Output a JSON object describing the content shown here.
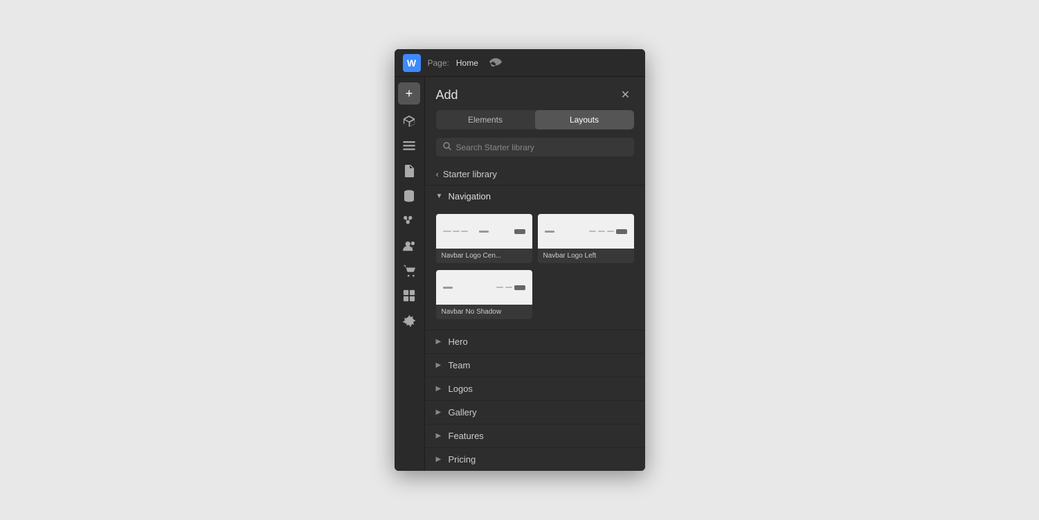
{
  "topbar": {
    "logo": "W",
    "page_prefix": "Page:",
    "page_name": "Home"
  },
  "sidebar": {
    "add_label": "+",
    "icons": [
      {
        "name": "cube-icon",
        "symbol": "⬡"
      },
      {
        "name": "layers-icon",
        "symbol": "≡"
      },
      {
        "name": "page-icon",
        "symbol": "❐"
      },
      {
        "name": "database-icon",
        "symbol": "◉"
      },
      {
        "name": "sitemap-icon",
        "symbol": "⊕"
      },
      {
        "name": "users-icon",
        "symbol": "👤"
      },
      {
        "name": "cart-icon",
        "symbol": "🛒"
      },
      {
        "name": "media-icon",
        "symbol": "▣"
      },
      {
        "name": "settings-icon",
        "symbol": "⚙"
      }
    ]
  },
  "panel": {
    "title": "Add",
    "close_label": "✕",
    "tabs": [
      {
        "id": "elements",
        "label": "Elements"
      },
      {
        "id": "layouts",
        "label": "Layouts"
      }
    ],
    "active_tab": "layouts",
    "search": {
      "placeholder": "Search Starter library"
    },
    "back_label": "Starter library",
    "navigation_section": {
      "title": "Navigation",
      "expanded": true,
      "cards": [
        {
          "label": "Navbar Logo Cen...",
          "type": "center"
        },
        {
          "label": "Navbar Logo Left",
          "type": "left"
        },
        {
          "label": "Navbar No Shadow",
          "type": "noshadow"
        }
      ]
    },
    "collapsed_sections": [
      {
        "title": "Hero"
      },
      {
        "title": "Team"
      },
      {
        "title": "Logos"
      },
      {
        "title": "Gallery"
      },
      {
        "title": "Features"
      },
      {
        "title": "Pricing"
      }
    ]
  }
}
